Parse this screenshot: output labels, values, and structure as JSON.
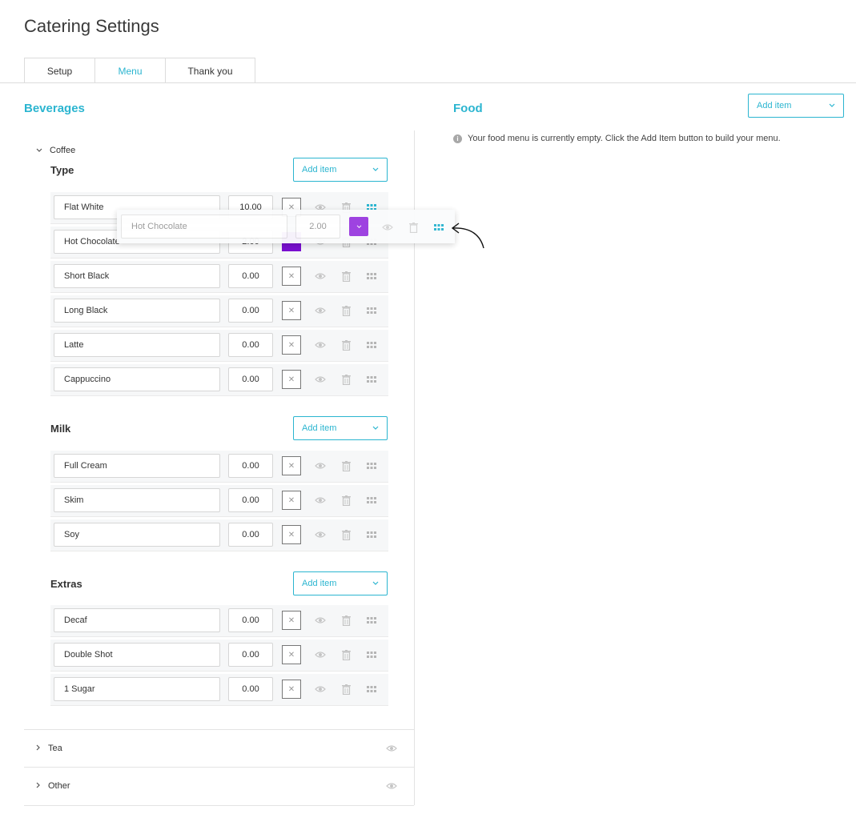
{
  "page": {
    "title": "Catering Settings"
  },
  "tabs": [
    {
      "label": "Setup",
      "active": false
    },
    {
      "label": "Menu",
      "active": true
    },
    {
      "label": "Thank you",
      "active": false
    }
  ],
  "beverages": {
    "heading": "Beverages",
    "categories": {
      "coffee": {
        "label": "Coffee",
        "groups": {
          "type": {
            "title": "Type",
            "add_label": "Add item",
            "items": [
              {
                "name": "Flat White",
                "price": "10.00",
                "color": "none"
              },
              {
                "name": "Hot Chocolate",
                "price": "2.00",
                "color": "#7a0fd0"
              },
              {
                "name": "Short Black",
                "price": "0.00",
                "color": "none"
              },
              {
                "name": "Long Black",
                "price": "0.00",
                "color": "none"
              },
              {
                "name": "Latte",
                "price": "0.00",
                "color": "none"
              },
              {
                "name": "Cappuccino",
                "price": "0.00",
                "color": "none"
              }
            ]
          },
          "milk": {
            "title": "Milk",
            "add_label": "Add item",
            "items": [
              {
                "name": "Full Cream",
                "price": "0.00",
                "color": "none"
              },
              {
                "name": "Skim",
                "price": "0.00",
                "color": "none"
              },
              {
                "name": "Soy",
                "price": "0.00",
                "color": "none"
              }
            ]
          },
          "extras": {
            "title": "Extras",
            "add_label": "Add item",
            "items": [
              {
                "name": "Decaf",
                "price": "0.00",
                "color": "none"
              },
              {
                "name": "Double Shot",
                "price": "0.00",
                "color": "none"
              },
              {
                "name": "1 Sugar",
                "price": "0.00",
                "color": "none"
              }
            ]
          }
        }
      },
      "tea": {
        "label": "Tea"
      },
      "other": {
        "label": "Other"
      }
    }
  },
  "food": {
    "heading": "Food",
    "add_label": "Add item",
    "empty_message": "Your food menu is currently empty. Click the Add Item button to build your menu."
  },
  "drag_ghost": {
    "name": "Hot Chocolate",
    "price": "2.00",
    "color": "#9b3ce0"
  },
  "colors": {
    "accent": "#2bb5d0",
    "purple": "#7a0fd0",
    "grip_active": "#2bb5d0"
  },
  "icons": [
    "chevron-down-icon",
    "chevron-right-icon",
    "eye-icon",
    "trash-icon",
    "grip-icon",
    "close-icon",
    "info-icon",
    "arrow-icon"
  ]
}
